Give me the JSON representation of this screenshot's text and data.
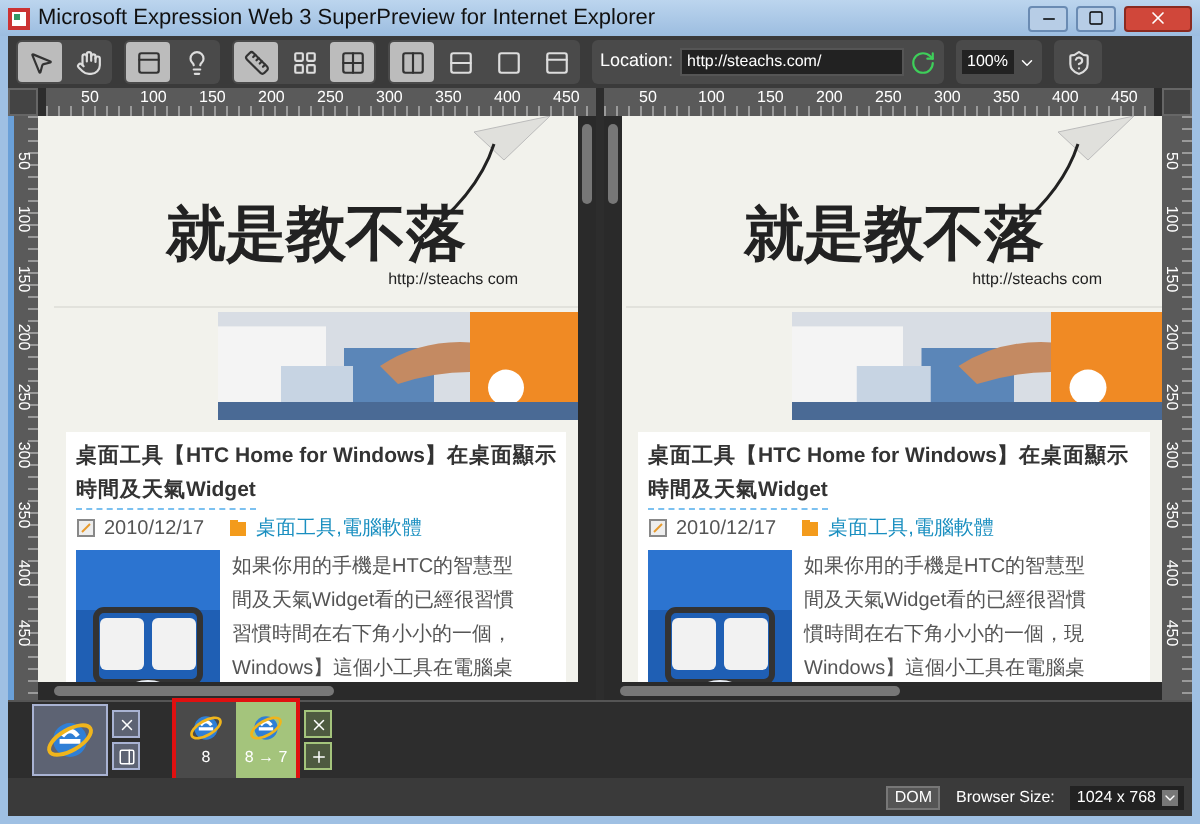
{
  "window": {
    "title": "Microsoft Expression Web 3 SuperPreview for Internet Explorer"
  },
  "tool_groups": [
    {
      "tools": [
        {
          "kind": "pointer",
          "selected": true
        },
        {
          "kind": "hand",
          "selected": false
        }
      ]
    },
    {
      "tools": [
        {
          "kind": "layout",
          "selected": true
        },
        {
          "kind": "bulb",
          "selected": false
        }
      ]
    },
    {
      "tools": [
        {
          "kind": "ruler",
          "selected": true
        },
        {
          "kind": "grid",
          "selected": false
        },
        {
          "kind": "crosshair",
          "selected": true
        }
      ]
    },
    {
      "tools": [
        {
          "kind": "sidebyside",
          "selected": true
        },
        {
          "kind": "stacked",
          "selected": false
        },
        {
          "kind": "overlay",
          "selected": false
        },
        {
          "kind": "single",
          "selected": false
        }
      ]
    }
  ],
  "location": {
    "label": "Location:",
    "value": "http://steachs.com/"
  },
  "zoom": {
    "value": "100%"
  },
  "panes": [
    {
      "ruler_marks": [
        "50",
        "100",
        "150",
        "200",
        "250",
        "300",
        "350",
        "400",
        "450"
      ],
      "side_ruler_marks": [
        "50",
        "100",
        "150",
        "200",
        "250",
        "300",
        "350",
        "400",
        "450"
      ],
      "logo": {
        "title": "就是教不落",
        "url": "http://steachs com"
      },
      "article": {
        "title_lines": [
          "桌面工具【HTC Home for Windows】在桌面顯示",
          "時間及天氣Widget"
        ],
        "date": "2010/12/17",
        "categories": "桌面工具,電腦軟體",
        "paragraph": [
          "如果你用的手機是HTC的智慧型",
          "間及天氣Widget看的已經很習慣",
          "習慣時間在右下角小小的一個，",
          "Windows】這個小工具在電腦桌"
        ]
      }
    },
    {
      "ruler_marks": [
        "50",
        "100",
        "150",
        "200",
        "250",
        "300",
        "350",
        "400",
        "450"
      ],
      "side_ruler_marks": [
        "50",
        "100",
        "150",
        "200",
        "250",
        "300",
        "350",
        "400",
        "450"
      ],
      "logo": {
        "title": "就是教不落",
        "url": "http://steachs com"
      },
      "article": {
        "title_lines": [
          "桌面工具【HTC Home for Windows】在桌面顯示",
          "時間及天氣Widget"
        ],
        "date": "2010/12/17",
        "categories": "桌面工具,電腦軟體",
        "paragraph": [
          "如果你用的手機是HTC的智慧型",
          "間及天氣Widget看的已經很習慣",
          "慣時間在右下角小小的一個，現",
          "Windows】這個小工具在電腦桌"
        ]
      }
    }
  ],
  "baseline": {
    "selected": true
  },
  "comparisons": [
    {
      "label": "8",
      "selected": false
    },
    {
      "label": "8 → 7",
      "selected": true
    }
  ],
  "status_bar": {
    "dom": "DOM",
    "browser_size_label": "Browser Size:",
    "browser_size": "1024 x 768"
  }
}
